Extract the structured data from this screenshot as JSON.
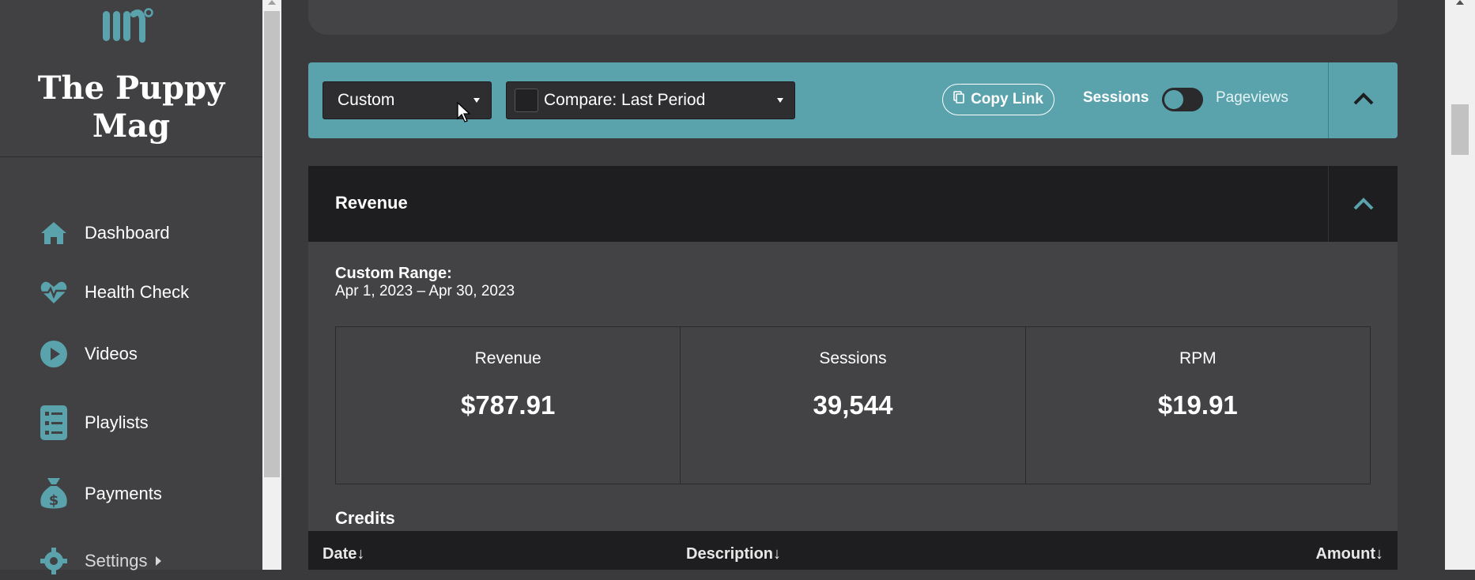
{
  "brand": {
    "name": "The Puppy\nMag",
    "logo_icon": "mm-logo-icon"
  },
  "sidebar": {
    "items": [
      {
        "label": "Dashboard",
        "icon": "home-icon"
      },
      {
        "label": "Health Check",
        "icon": "heartbeat-icon"
      },
      {
        "label": "Videos",
        "icon": "play-circle-icon"
      },
      {
        "label": "Playlists",
        "icon": "list-icon"
      },
      {
        "label": "Payments",
        "icon": "money-bag-icon"
      },
      {
        "label": "Settings",
        "icon": "gear-icon"
      }
    ]
  },
  "filters": {
    "date_range": "Custom",
    "compare": "Compare: Last Period",
    "copy_link": "Copy Link",
    "sessions": "Sessions",
    "pageviews": "Pageviews",
    "toggle_state": "sessions"
  },
  "revenue": {
    "title": "Revenue",
    "range_title": "Custom Range:",
    "range_value": "Apr 1, 2023 – Apr 30, 2023",
    "stats": [
      {
        "label": "Revenue",
        "value": "$787.91"
      },
      {
        "label": "Sessions",
        "value": "39,544"
      },
      {
        "label": "RPM",
        "value": "$19.91"
      }
    ]
  },
  "credits": {
    "title": "Credits",
    "columns": [
      "Date↓",
      "Description↓",
      "Amount↓"
    ]
  },
  "colors": {
    "accent": "#5aa3ad",
    "sidebar": "#414143",
    "background": "#3a3a3c",
    "header": "#1e1e20"
  }
}
